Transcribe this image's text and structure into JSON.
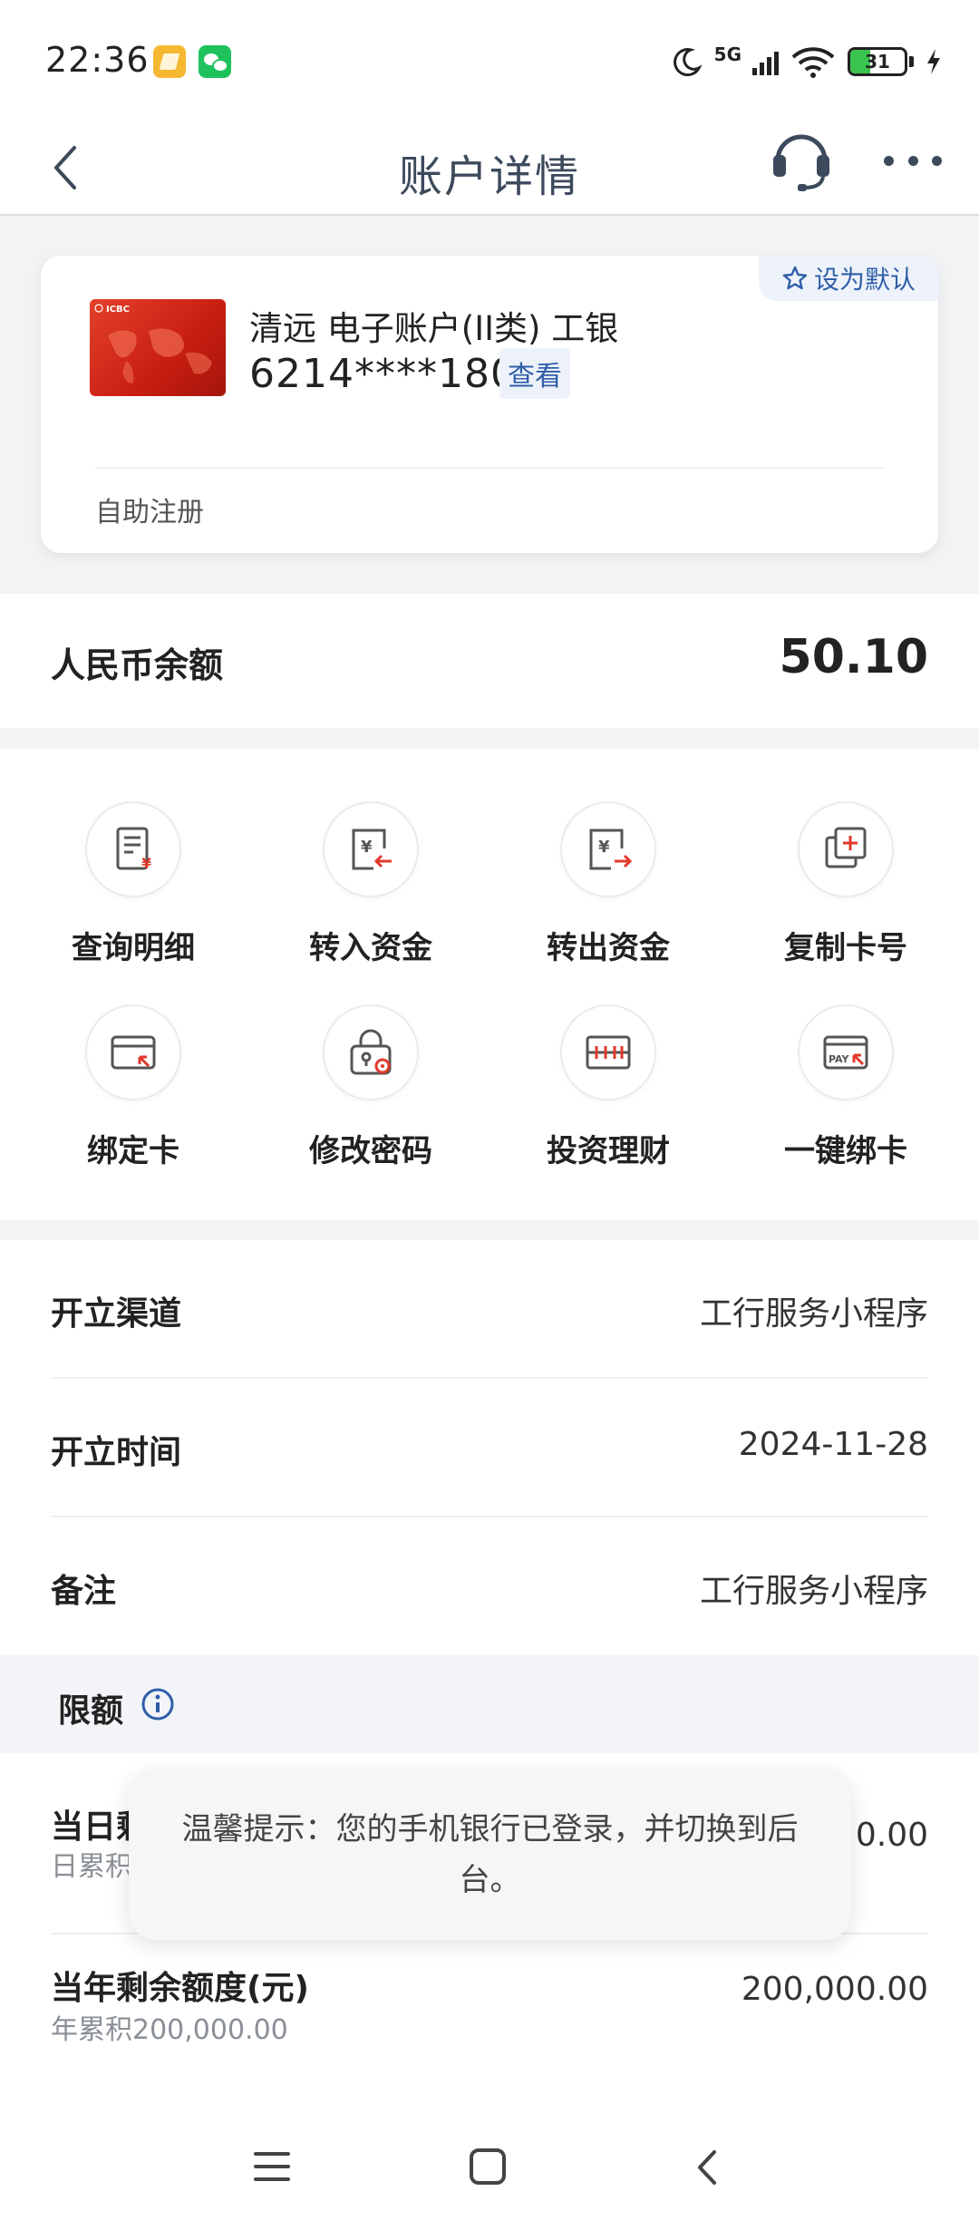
{
  "status_bar": {
    "time": "22:36",
    "network": "5G",
    "battery": "31",
    "battery_level": 0.31
  },
  "nav": {
    "title": "账户详情",
    "icons": [
      "back-icon",
      "headset-icon",
      "more-icon"
    ]
  },
  "card": {
    "default_label": "设为默认",
    "title": "清远 电子账户(II类) 工银",
    "number": "6214****1807",
    "view_label": "查看",
    "register_label": "自助注册"
  },
  "balance": {
    "label": "人民币余额",
    "value": "50.10"
  },
  "actions": [
    {
      "label": "查询明细",
      "icon": "statement-icon"
    },
    {
      "label": "转入资金",
      "icon": "transfer-in-icon"
    },
    {
      "label": "转出资金",
      "icon": "transfer-out-icon"
    },
    {
      "label": "复制卡号",
      "icon": "copy-icon"
    },
    {
      "label": "绑定卡",
      "icon": "bind-card-icon"
    },
    {
      "label": "修改密码",
      "icon": "lock-icon"
    },
    {
      "label": "投资理财",
      "icon": "abacus-icon"
    },
    {
      "label": "一键绑卡",
      "icon": "pay-card-icon"
    }
  ],
  "info": [
    {
      "label": "开立渠道",
      "value": "工行服务小程序"
    },
    {
      "label": "开立时间",
      "value": "2024-11-28"
    },
    {
      "label": "备注",
      "value": "工行服务小程序"
    }
  ],
  "limits": {
    "title": "限额",
    "daily_label": "当日剩余额度(元)",
    "daily_label_visible": "当日剩",
    "daily_sub_visible": "日累积",
    "daily_value_visible": "0.00",
    "annual_label": "当年剩余额度(元)",
    "annual_sub": "年累积200,000.00",
    "annual_value": "200,000.00"
  },
  "toast": {
    "text": "温馨提示：您的手机银行已登录，并切换到后台。"
  },
  "colors": {
    "accent": "#2f5ea8",
    "card_red": "#d42d1d",
    "icon_red": "#e0392b",
    "text": "#222222"
  }
}
